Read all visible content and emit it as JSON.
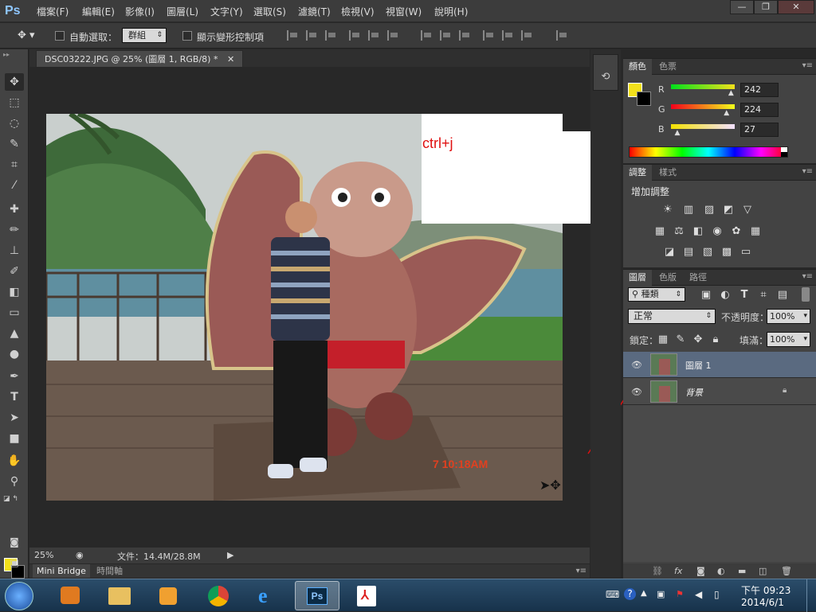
{
  "app": {
    "logo": "Ps"
  },
  "menu": [
    "檔案(F)",
    "編輯(E)",
    "影像(I)",
    "圖層(L)",
    "文字(Y)",
    "選取(S)",
    "濾鏡(T)",
    "檢視(V)",
    "視窗(W)",
    "說明(H)"
  ],
  "window_controls": {
    "minimize": "—",
    "restore": "❐",
    "close": "✕"
  },
  "options": {
    "auto_select_label": "自動選取：",
    "auto_select_value": "群組",
    "show_transform_label": "顯示變形控制項"
  },
  "document": {
    "tab_title": "DSC03222.JPG @ 25% (圖層 1, RGB/8) *",
    "tab_close": "✕",
    "annotation": "ctrl+j",
    "photo_timestamp": "7 10:18AM",
    "zoom": "25%",
    "file_info": "文件：14.4M/28.8M"
  },
  "bottom_tabs": {
    "mini_bridge": "Mini Bridge",
    "timeline": "時間軸"
  },
  "color_panel": {
    "tabs": [
      "顏色",
      "色票"
    ],
    "r_label": "R",
    "g_label": "G",
    "b_label": "B",
    "r": "242",
    "g": "224",
    "b": "27",
    "r_frac": 0.949,
    "g_frac": 0.878,
    "b_frac": 0.106,
    "fg_color": "#f2e01b",
    "bg_color": "#000000"
  },
  "adjust_panel": {
    "tabs": [
      "調整",
      "樣式"
    ],
    "heading": "增加調整"
  },
  "layers_panel": {
    "tabs": [
      "圖層",
      "色版",
      "路徑"
    ],
    "filter_kind": "種類",
    "blend_mode": "正常",
    "opacity_label": "不透明度：",
    "opacity": "100%",
    "lock_label": "鎖定：",
    "fill_label": "填滿：",
    "fill": "100%",
    "layers": [
      {
        "name": "圖層 1",
        "selected": true
      },
      {
        "name": "背景",
        "selected": false
      }
    ]
  },
  "taskbar": {
    "time": "下午 09:23",
    "date": "2014/6/1"
  },
  "colors": {
    "accent_selected_layer": "#5a6a80",
    "annotation_red": "#e01010"
  }
}
